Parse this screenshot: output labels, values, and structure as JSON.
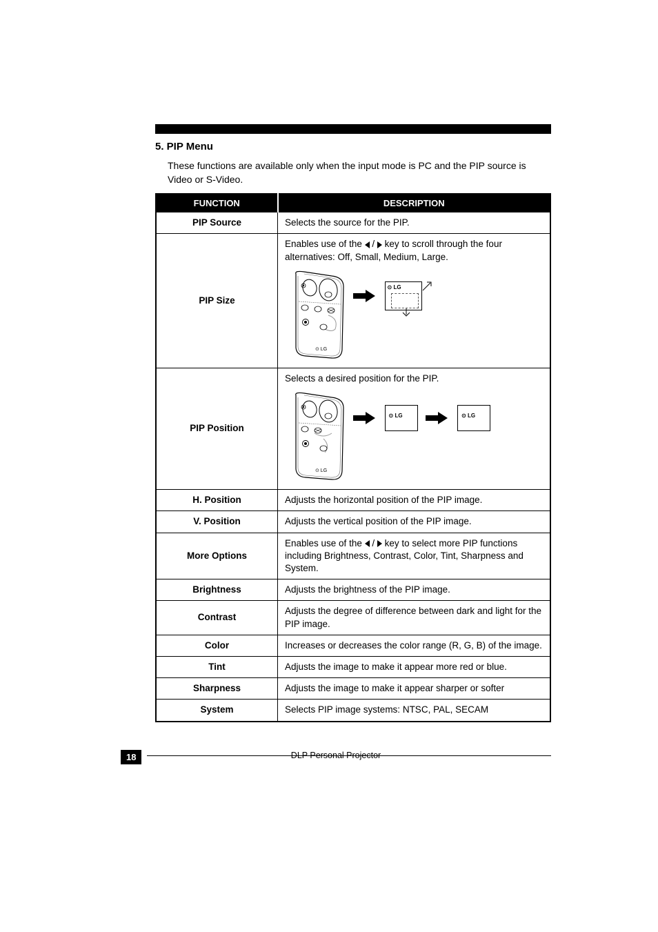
{
  "section": {
    "title": "5. PIP Menu",
    "intro": "These functions are available only when the input mode is PC and the PIP source is Video or S-Video."
  },
  "table": {
    "header": {
      "function": "FUNCTION",
      "description": "DESCRIPTION"
    },
    "rows": {
      "pip_source": {
        "func": "PIP Source",
        "desc": "Selects the source for the PIP."
      },
      "pip_size": {
        "func": "PIP Size",
        "desc_a": "Enables use of the ",
        "desc_b": " / ",
        "desc_c": " key to scroll through the four alternatives: Off, Small, Medium, Large."
      },
      "pip_position": {
        "func": "PIP Position",
        "desc": "Selects a desired position for the PIP."
      },
      "h_position": {
        "func": "H. Position",
        "desc": "Adjusts the horizontal position of the PIP image."
      },
      "v_position": {
        "func": "V. Position",
        "desc": "Adjusts the vertical position of the PIP image."
      },
      "more_options": {
        "func": "More Options",
        "desc_a": "Enables use of the ",
        "desc_b": " / ",
        "desc_c": " key to select more PIP functions including Brightness, Contrast, Color, Tint, Sharpness and System."
      },
      "brightness": {
        "func": "Brightness",
        "desc": "Adjusts the brightness of the PIP image."
      },
      "contrast": {
        "func": "Contrast",
        "desc": "Adjusts the degree of difference between dark and light for the PIP image."
      },
      "color": {
        "func": "Color",
        "desc": "Increases or decreases the color range (R, G, B) of the image."
      },
      "tint": {
        "func": "Tint",
        "desc": "Adjusts the image to make it appear more red or blue."
      },
      "sharpness": {
        "func": "Sharpness",
        "desc": "Adjusts the image to make it appear sharper or softer"
      },
      "system": {
        "func": "System",
        "desc": "Selects PIP image systems: NTSC, PAL, SECAM"
      }
    }
  },
  "lg_label": "LG",
  "footer": {
    "page": "18",
    "text": "DLP Personal Projector"
  }
}
